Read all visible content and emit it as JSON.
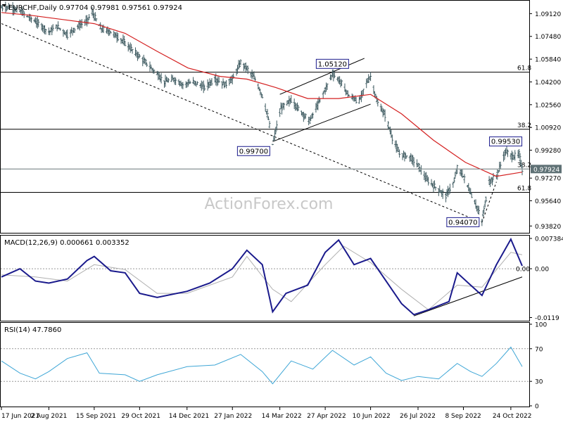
{
  "watermark": "ActionForex.com",
  "colors": {
    "background": "#ffffff",
    "bars": "#3f5b61",
    "ma": "#d42020",
    "macd": "#1a1a8c",
    "signal": "#b0b0b0",
    "rsi": "#3ea6d6",
    "trendline": "#000000",
    "level": "#000000",
    "current_price_bg": "#5f7175"
  },
  "price_panel": {
    "header": "EURCHF,Daily  0.97704  0.97981  0.97561  0.97924",
    "ylim": [
      0.9338,
      1.1
    ],
    "y_ticks": [
      {
        "value": 1.0912,
        "label": "1.09120"
      },
      {
        "value": 1.0748,
        "label": "1.07480"
      },
      {
        "value": 1.0584,
        "label": "1.05840"
      },
      {
        "value": 1.042,
        "label": "1.04200"
      },
      {
        "value": 1.0256,
        "label": "1.02560"
      },
      {
        "value": 1.0092,
        "label": "1.00920"
      },
      {
        "value": 0.9928,
        "label": "0.99280"
      },
      {
        "value": 0.9727,
        "label": "0.97270"
      },
      {
        "value": 0.9564,
        "label": "0.95640"
      },
      {
        "value": 0.9382,
        "label": "0.93820"
      }
    ],
    "current_price": {
      "value": 0.97924,
      "label": "0.97924"
    },
    "fib_levels": [
      {
        "value": 1.049,
        "label": "61.8"
      },
      {
        "value": 1.0079,
        "label": "38.2"
      },
      {
        "value": 0.9792,
        "label": "38.2"
      },
      {
        "value": 0.9624,
        "label": "61.8"
      }
    ],
    "callouts": [
      {
        "date": "2022-05-04",
        "value": 1.0512,
        "label": "1.05120"
      },
      {
        "date": "2022-03-07",
        "value": 0.997,
        "label": "0.99700"
      },
      {
        "date": "2022-10-19",
        "value": 0.9953,
        "label": "0.99530"
      },
      {
        "date": "2022-09-26",
        "value": 0.9407,
        "label": "0.94070"
      }
    ]
  },
  "macd_panel": {
    "header": "MACD(12,26,9)  0.000661  0.003352",
    "ylim": [
      -0.0125,
      0.0079
    ],
    "y_ticks": [
      {
        "value": 0.007384,
        "label": "0.007384"
      },
      {
        "value": 0.0,
        "label": "0.00"
      },
      {
        "value": -0.0119,
        "label": "-0.0119"
      }
    ],
    "current_value_label": "0.00"
  },
  "rsi_panel": {
    "header": "RSI(14)  47.7860",
    "ylim": [
      0,
      100
    ],
    "y_ticks": [
      {
        "value": 100,
        "label": "100"
      },
      {
        "value": 70,
        "label": "70"
      },
      {
        "value": 30,
        "label": "30"
      },
      {
        "value": 0,
        "label": "0"
      }
    ]
  },
  "x_axis": {
    "ticks": [
      {
        "date": "2021-06-17",
        "label": "17 Jun 2021"
      },
      {
        "date": "2021-08-02",
        "label": "2 Aug 2021"
      },
      {
        "date": "2021-09-15",
        "label": "15 Sep 2021"
      },
      {
        "date": "2021-10-29",
        "label": "29 Oct 2021"
      },
      {
        "date": "2021-12-14",
        "label": "14 Dec 2021"
      },
      {
        "date": "2022-01-27",
        "label": "27 Jan 2022"
      },
      {
        "date": "2022-03-14",
        "label": "14 Mar 2022"
      },
      {
        "date": "2022-04-27",
        "label": "27 Apr 2022"
      },
      {
        "date": "2022-06-10",
        "label": "10 Jun 2022"
      },
      {
        "date": "2022-07-26",
        "label": "26 Jul 2022"
      },
      {
        "date": "2022-09-08",
        "label": "8 Sep 2022"
      },
      {
        "date": "2022-10-24",
        "label": "24 Oct 2022"
      }
    ]
  },
  "chart_data": [
    {
      "type": "ohlc",
      "title": "EURCHF,Daily",
      "last": {
        "open": 0.97704,
        "high": 0.97981,
        "low": 0.97561,
        "close": 0.97924
      },
      "price_path": [
        [
          "2021-06-17",
          1.0955
        ],
        [
          "2021-06-25",
          1.096
        ],
        [
          "2021-07-05",
          1.093
        ],
        [
          "2021-07-15",
          1.088
        ],
        [
          "2021-07-23",
          1.084
        ],
        [
          "2021-08-02",
          1.078
        ],
        [
          "2021-08-10",
          1.082
        ],
        [
          "2021-08-20",
          1.076
        ],
        [
          "2021-08-30",
          1.082
        ],
        [
          "2021-09-08",
          1.086
        ],
        [
          "2021-09-13",
          1.092
        ],
        [
          "2021-09-22",
          1.08
        ],
        [
          "2021-10-01",
          1.078
        ],
        [
          "2021-10-12",
          1.072
        ],
        [
          "2021-10-22",
          1.065
        ],
        [
          "2021-11-01",
          1.058
        ],
        [
          "2021-11-12",
          1.05
        ],
        [
          "2021-11-22",
          1.042
        ],
        [
          "2021-12-01",
          1.044
        ],
        [
          "2021-12-10",
          1.04
        ],
        [
          "2021-12-20",
          1.042
        ],
        [
          "2021-12-31",
          1.038
        ],
        [
          "2022-01-10",
          1.044
        ],
        [
          "2022-01-20",
          1.04
        ],
        [
          "2022-01-28",
          1.045
        ],
        [
          "2022-02-04",
          1.056
        ],
        [
          "2022-02-10",
          1.052
        ],
        [
          "2022-02-18",
          1.044
        ],
        [
          "2022-02-25",
          1.032
        ],
        [
          "2022-03-03",
          1.015
        ],
        [
          "2022-03-07",
          0.997
        ],
        [
          "2022-03-15",
          1.023
        ],
        [
          "2022-03-25",
          1.029
        ],
        [
          "2022-04-04",
          1.02
        ],
        [
          "2022-04-12",
          1.014
        ],
        [
          "2022-04-20",
          1.026
        ],
        [
          "2022-04-28",
          1.038
        ],
        [
          "2022-05-04",
          1.048
        ],
        [
          "2022-05-12",
          1.042
        ],
        [
          "2022-05-20",
          1.032
        ],
        [
          "2022-05-30",
          1.028
        ],
        [
          "2022-06-05",
          1.04
        ],
        [
          "2022-06-10",
          1.046
        ],
        [
          "2022-06-16",
          1.028
        ],
        [
          "2022-06-24",
          1.018
        ],
        [
          "2022-07-01",
          1.002
        ],
        [
          "2022-07-08",
          0.99
        ],
        [
          "2022-07-18",
          0.988
        ],
        [
          "2022-07-26",
          0.982
        ],
        [
          "2022-08-03",
          0.972
        ],
        [
          "2022-08-12",
          0.966
        ],
        [
          "2022-08-22",
          0.96
        ],
        [
          "2022-08-30",
          0.97
        ],
        [
          "2022-09-02",
          0.98
        ],
        [
          "2022-09-08",
          0.974
        ],
        [
          "2022-09-15",
          0.962
        ],
        [
          "2022-09-21",
          0.952
        ],
        [
          "2022-09-26",
          0.942
        ],
        [
          "2022-10-03",
          0.97
        ],
        [
          "2022-10-10",
          0.974
        ],
        [
          "2022-10-19",
          0.992
        ],
        [
          "2022-10-26",
          0.988
        ],
        [
          "2022-11-01",
          0.99
        ],
        [
          "2022-11-04",
          0.9792
        ]
      ],
      "series": [
        {
          "name": "EURCHF",
          "style": "ohlc-bars"
        },
        {
          "style": "moving-average"
        }
      ],
      "ma_path": [
        [
          "2021-06-17",
          1.092
        ],
        [
          "2021-07-15",
          1.09
        ],
        [
          "2021-08-15",
          1.087
        ],
        [
          "2021-09-15",
          1.084
        ],
        [
          "2021-10-15",
          1.077
        ],
        [
          "2021-11-15",
          1.064
        ],
        [
          "2021-12-15",
          1.052
        ],
        [
          "2022-01-15",
          1.046
        ],
        [
          "2022-02-10",
          1.044
        ],
        [
          "2022-03-10",
          1.038
        ],
        [
          "2022-04-10",
          1.03
        ],
        [
          "2022-05-10",
          1.03
        ],
        [
          "2022-06-10",
          1.033
        ],
        [
          "2022-07-10",
          1.019
        ],
        [
          "2022-08-10",
          1.0
        ],
        [
          "2022-09-10",
          0.984
        ],
        [
          "2022-10-10",
          0.974
        ],
        [
          "2022-11-04",
          0.977
        ]
      ],
      "trendlines": [
        {
          "style": "dashed",
          "from": [
            "2021-06-17",
            1.084
          ],
          "to": [
            "2022-09-26",
            0.9407
          ]
        },
        {
          "style": "dashed",
          "from": [
            "2022-09-26",
            0.9407
          ],
          "to": [
            "2022-10-10",
            0.97
          ]
        },
        {
          "style": "solid",
          "from": [
            "2022-03-07",
            0.999
          ],
          "to": [
            "2022-06-10",
            1.026
          ]
        },
        {
          "style": "solid",
          "from": [
            "2022-03-14",
            1.033
          ],
          "to": [
            "2022-06-04",
            1.059
          ]
        }
      ]
    },
    {
      "type": "line",
      "title": "MACD(12,26,9)",
      "last": {
        "macd": 0.000661,
        "signal": 0.003352
      },
      "series": [
        {
          "name": "MACD",
          "points": [
            [
              "2021-06-17",
              -0.002
            ],
            [
              "2021-07-05",
              0.0
            ],
            [
              "2021-07-20",
              -0.003
            ],
            [
              "2021-08-02",
              -0.0035
            ],
            [
              "2021-08-20",
              -0.0025
            ],
            [
              "2021-09-08",
              0.002
            ],
            [
              "2021-09-15",
              0.003
            ],
            [
              "2021-10-01",
              -0.0005
            ],
            [
              "2021-10-15",
              -0.001
            ],
            [
              "2021-10-29",
              -0.006
            ],
            [
              "2021-11-15",
              -0.007
            ],
            [
              "2021-12-14",
              -0.0055
            ],
            [
              "2022-01-05",
              -0.0035
            ],
            [
              "2022-01-27",
              0.0
            ],
            [
              "2022-02-10",
              0.0045
            ],
            [
              "2022-02-25",
              0.001
            ],
            [
              "2022-03-07",
              -0.0105
            ],
            [
              "2022-03-20",
              -0.006
            ],
            [
              "2022-04-10",
              -0.004
            ],
            [
              "2022-04-27",
              0.004
            ],
            [
              "2022-05-10",
              0.007
            ],
            [
              "2022-05-25",
              0.001
            ],
            [
              "2022-06-10",
              0.0025
            ],
            [
              "2022-06-25",
              -0.003
            ],
            [
              "2022-07-10",
              -0.0085
            ],
            [
              "2022-07-22",
              -0.0112
            ],
            [
              "2022-08-05",
              -0.01
            ],
            [
              "2022-08-25",
              -0.008
            ],
            [
              "2022-09-02",
              -0.001
            ],
            [
              "2022-09-15",
              -0.004
            ],
            [
              "2022-09-26",
              -0.0065
            ],
            [
              "2022-10-10",
              0.001
            ],
            [
              "2022-10-24",
              0.0072
            ],
            [
              "2022-11-04",
              0.0007
            ]
          ]
        },
        {
          "name": "Signal",
          "points": [
            [
              "2021-06-17",
              -0.0015
            ],
            [
              "2021-07-20",
              -0.002
            ],
            [
              "2021-08-20",
              -0.003
            ],
            [
              "2021-09-15",
              0.001
            ],
            [
              "2021-10-15",
              -0.0002
            ],
            [
              "2021-11-15",
              -0.006
            ],
            [
              "2021-12-14",
              -0.006
            ],
            [
              "2022-01-27",
              -0.002
            ],
            [
              "2022-02-10",
              0.003
            ],
            [
              "2022-03-07",
              -0.005
            ],
            [
              "2022-03-25",
              -0.008
            ],
            [
              "2022-04-27",
              0.001
            ],
            [
              "2022-05-15",
              0.0055
            ],
            [
              "2022-06-10",
              0.0015
            ],
            [
              "2022-07-10",
              -0.005
            ],
            [
              "2022-08-05",
              -0.01
            ],
            [
              "2022-09-02",
              -0.004
            ],
            [
              "2022-09-26",
              -0.0045
            ],
            [
              "2022-10-24",
              0.004
            ],
            [
              "2022-11-04",
              0.0034
            ]
          ]
        }
      ],
      "trendlines": [
        {
          "style": "solid",
          "from": [
            "2022-07-22",
            -0.0115
          ],
          "to": [
            "2022-11-04",
            -0.002
          ]
        }
      ]
    },
    {
      "type": "line",
      "title": "RSI(14)",
      "last": {
        "rsi": 47.786
      },
      "reference_lines": [
        70,
        30
      ],
      "series": [
        {
          "name": "RSI",
          "points": [
            [
              "2021-06-17",
              55
            ],
            [
              "2021-07-05",
              40
            ],
            [
              "2021-07-20",
              33
            ],
            [
              "2021-08-02",
              42
            ],
            [
              "2021-08-20",
              58
            ],
            [
              "2021-09-08",
              65
            ],
            [
              "2021-09-20",
              40
            ],
            [
              "2021-10-15",
              38
            ],
            [
              "2021-10-29",
              30
            ],
            [
              "2021-11-15",
              38
            ],
            [
              "2021-12-14",
              48
            ],
            [
              "2022-01-10",
              50
            ],
            [
              "2022-02-04",
              63
            ],
            [
              "2022-02-25",
              42
            ],
            [
              "2022-03-07",
              27
            ],
            [
              "2022-03-25",
              55
            ],
            [
              "2022-04-15",
              45
            ],
            [
              "2022-05-04",
              68
            ],
            [
              "2022-05-25",
              50
            ],
            [
              "2022-06-10",
              60
            ],
            [
              "2022-06-25",
              40
            ],
            [
              "2022-07-10",
              31
            ],
            [
              "2022-07-26",
              36
            ],
            [
              "2022-08-15",
              33
            ],
            [
              "2022-09-02",
              52
            ],
            [
              "2022-09-15",
              42
            ],
            [
              "2022-09-26",
              36
            ],
            [
              "2022-10-10",
              52
            ],
            [
              "2022-10-24",
              72
            ],
            [
              "2022-11-04",
              48
            ]
          ]
        }
      ]
    }
  ]
}
